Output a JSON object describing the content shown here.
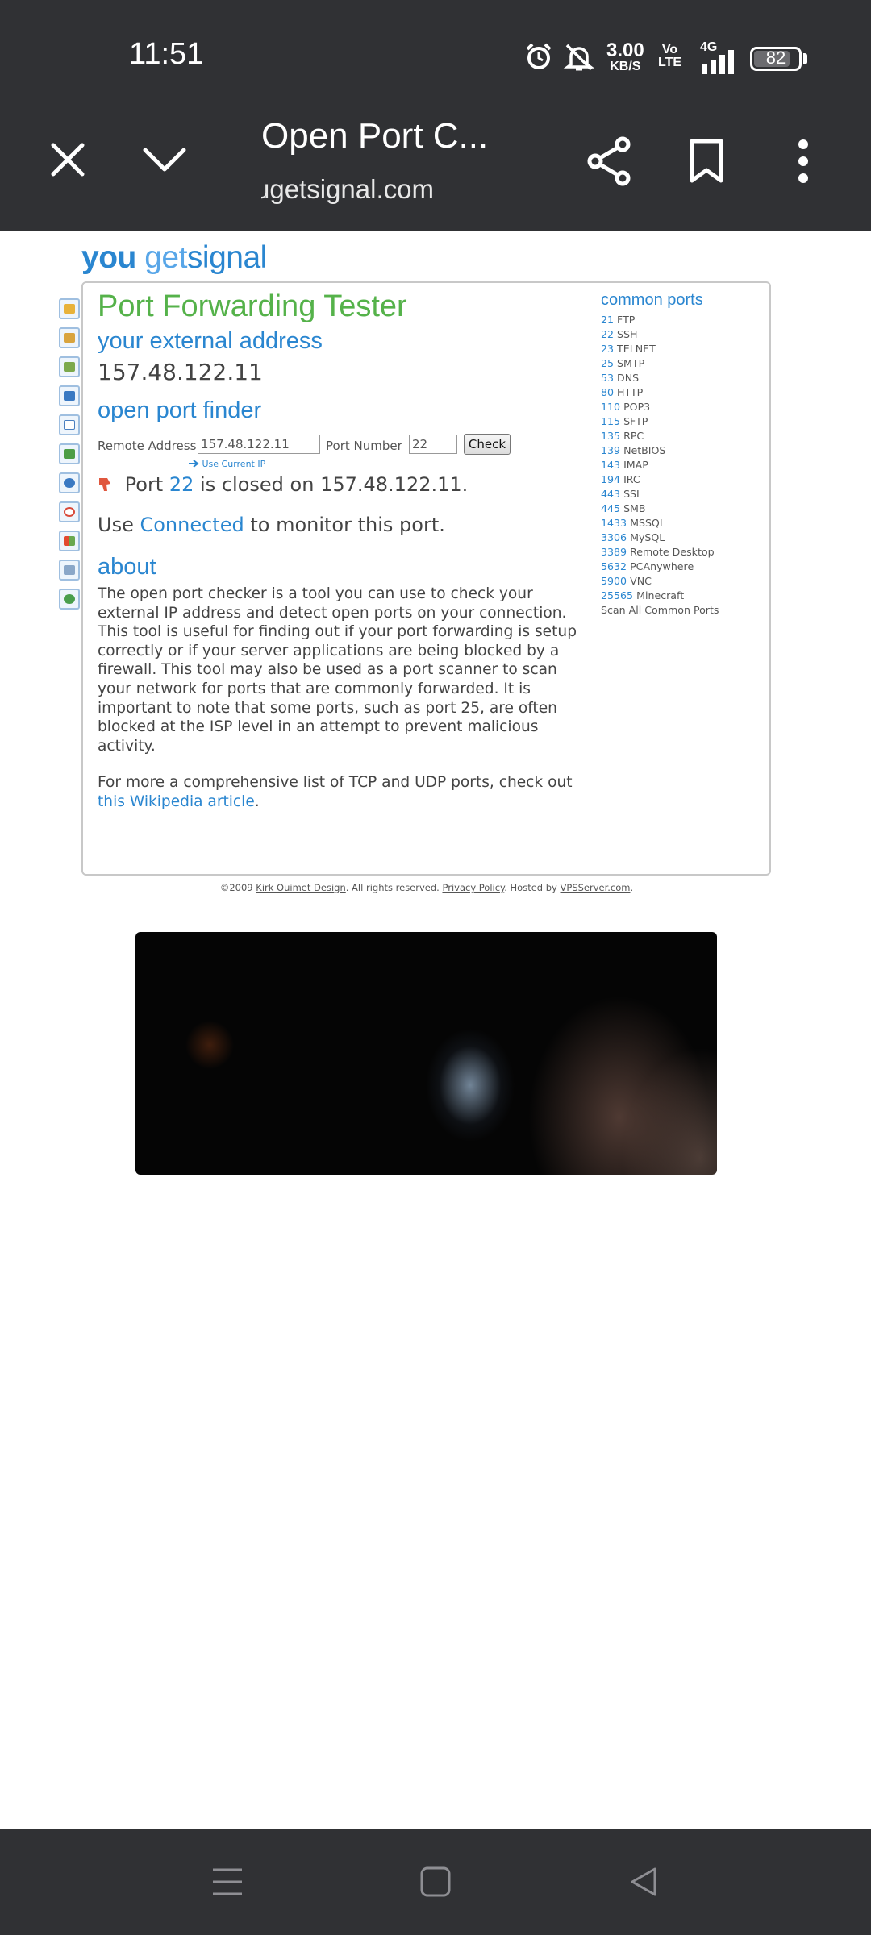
{
  "status_bar": {
    "time": "11:51",
    "net_speed_value": "3.00",
    "net_speed_unit": "KB/S",
    "volte_top": "Vo",
    "volte_bottom": "LTE",
    "network_type": "4G",
    "battery": "82",
    "battery_level_pct": 82
  },
  "browser": {
    "title": "Open Port C...",
    "url": "ugetsignal.com",
    "icons": [
      "close-icon",
      "chevron-down-icon",
      "share-icon",
      "bookmark-icon",
      "more-vert-icon"
    ]
  },
  "site": {
    "logo": {
      "you": "you",
      "get": "get",
      "signal": "signal"
    },
    "side_icons": [
      "lock-icon",
      "image-icon",
      "map-icon",
      "window-icon",
      "mail-icon",
      "network-icon",
      "help-icon",
      "google-icon",
      "windows-icon",
      "drive-icon",
      "globe-icon"
    ],
    "title": "Port Forwarding Tester",
    "external_address_heading": "your external address",
    "external_ip": "157.48.122.11",
    "finder_heading": "open port finder",
    "remote_address_label": "Remote Address",
    "remote_address_value": "157.48.122.11",
    "port_number_label": "Port Number",
    "port_number_value": "22",
    "check_button": "Check",
    "use_current_ip": "Use Current IP",
    "result": {
      "pre": "Port",
      "port": "22",
      "mid": "is closed on",
      "ip": "157.48.122.11."
    },
    "connected": {
      "pre": "Use",
      "link": "Connected",
      "post": "to monitor this port."
    },
    "about_heading": "about",
    "about_text": "The open port checker is a tool you can use to check your external IP address and detect open ports on your connection. This tool is useful for finding out if your port forwarding is setup correctly or if your server applications are being blocked by a firewall. This tool may also be used as a port scanner to scan your network for ports that are commonly forwarded. It is important to note that some ports, such as port 25, are often blocked at the ISP level in an attempt to prevent malicious activity.",
    "more_text_pre": "For more a comprehensive list of TCP and UDP ports, check out",
    "more_text_link": "this Wikipedia article",
    "more_text_post": ".",
    "common_ports_heading": "common ports",
    "common_ports": [
      {
        "port": "21",
        "name": "FTP"
      },
      {
        "port": "22",
        "name": "SSH"
      },
      {
        "port": "23",
        "name": "TELNET"
      },
      {
        "port": "25",
        "name": "SMTP"
      },
      {
        "port": "53",
        "name": "DNS"
      },
      {
        "port": "80",
        "name": "HTTP"
      },
      {
        "port": "110",
        "name": "POP3"
      },
      {
        "port": "115",
        "name": "SFTP"
      },
      {
        "port": "135",
        "name": "RPC"
      },
      {
        "port": "139",
        "name": "NetBIOS"
      },
      {
        "port": "143",
        "name": "IMAP"
      },
      {
        "port": "194",
        "name": "IRC"
      },
      {
        "port": "443",
        "name": "SSL"
      },
      {
        "port": "445",
        "name": "SMB"
      },
      {
        "port": "1433",
        "name": "MSSQL"
      },
      {
        "port": "3306",
        "name": "MySQL"
      },
      {
        "port": "3389",
        "name": "Remote Desktop"
      },
      {
        "port": "5632",
        "name": "PCAnywhere"
      },
      {
        "port": "5900",
        "name": "VNC"
      },
      {
        "port": "25565",
        "name": "Minecraft"
      }
    ],
    "scan_all": "Scan All Common Ports",
    "footer": {
      "copyright": "©2009",
      "author": "Kirk Ouimet Design",
      "rights": ". All rights reserved.",
      "privacy": "Privacy Policy",
      "hosted": ". Hosted by",
      "host": "VPSServer.com",
      "end": "."
    }
  },
  "nav_bar": {
    "icons": [
      "menu-icon",
      "home-icon",
      "back-icon"
    ]
  },
  "colors": {
    "chrome_bg": "#303134",
    "link_blue": "#2a86d0",
    "title_green": "#55b24a"
  }
}
